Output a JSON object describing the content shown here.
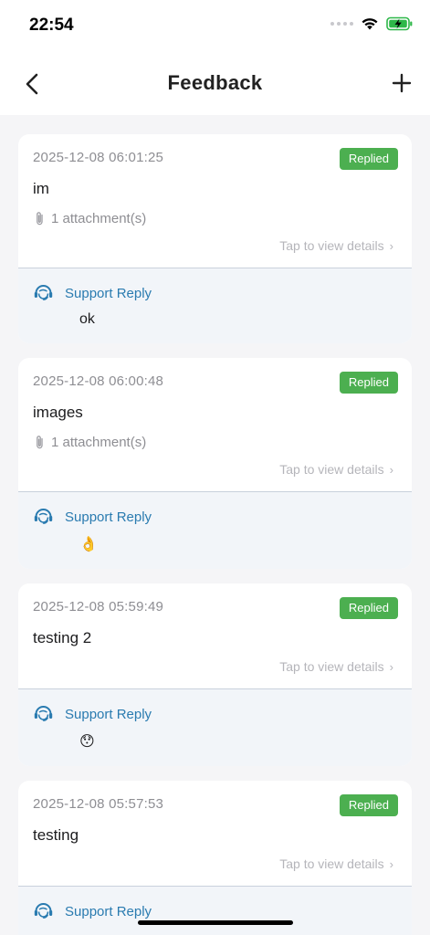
{
  "status": {
    "time": "22:54"
  },
  "nav": {
    "title": "Feedback"
  },
  "feedback": [
    {
      "date": "2025-12-08 06:01:25",
      "status": "Replied",
      "content": "im",
      "attachments": "1 attachment(s)",
      "details_link": "Tap to view details",
      "reply_label": "Support Reply",
      "reply_text": "ok"
    },
    {
      "date": "2025-12-08 06:00:48",
      "status": "Replied",
      "content": "images",
      "attachments": "1 attachment(s)",
      "details_link": "Tap to view details",
      "reply_label": "Support Reply",
      "reply_text": "👌"
    },
    {
      "date": "2025-12-08 05:59:49",
      "status": "Replied",
      "content": "testing 2",
      "attachments": null,
      "details_link": "Tap to view details",
      "reply_label": "Support Reply",
      "reply_text": "😯"
    },
    {
      "date": "2025-12-08 05:57:53",
      "status": "Replied",
      "content": "testing",
      "attachments": null,
      "details_link": "Tap to view details",
      "reply_label": "Support Reply",
      "reply_text": ""
    }
  ],
  "colors": {
    "badge": "#4caf50",
    "reply_accent": "#2a7bb0",
    "reply_bg": "#f2f5f9"
  }
}
